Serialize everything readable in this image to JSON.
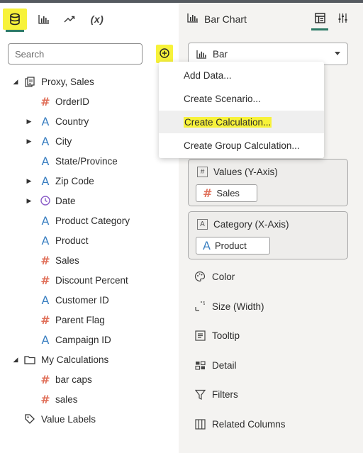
{
  "left_tabs": {
    "data_icon": "database-icon",
    "visualize_icon": "bar-chart-icon",
    "analytics_icon": "trend-line-icon",
    "calc_label": "(x)"
  },
  "search": {
    "placeholder": "Search",
    "value": ""
  },
  "add_button_icon": "plus-circle-icon",
  "tree": {
    "dataset": {
      "label": "Proxy, Sales",
      "icon": "dataset-icon"
    },
    "columns": [
      {
        "label": "OrderID",
        "type": "measure",
        "expandable": false
      },
      {
        "label": "Country",
        "type": "attribute",
        "expandable": true
      },
      {
        "label": "City",
        "type": "attribute",
        "expandable": true
      },
      {
        "label": "State/Province",
        "type": "attribute",
        "expandable": false
      },
      {
        "label": "Zip Code",
        "type": "attribute",
        "expandable": true
      },
      {
        "label": "Date",
        "type": "time",
        "expandable": true
      },
      {
        "label": "Product Category",
        "type": "attribute",
        "expandable": false
      },
      {
        "label": "Product",
        "type": "attribute",
        "expandable": false
      },
      {
        "label": "Sales",
        "type": "measure",
        "expandable": false
      },
      {
        "label": "Discount Percent",
        "type": "measure",
        "expandable": false
      },
      {
        "label": "Customer ID",
        "type": "attribute",
        "expandable": false
      },
      {
        "label": "Parent Flag",
        "type": "measure",
        "expandable": false
      },
      {
        "label": "Campaign ID",
        "type": "attribute",
        "expandable": false
      }
    ],
    "calculations": {
      "label": "My Calculations",
      "items": [
        {
          "label": "bar caps",
          "type": "measure"
        },
        {
          "label": "sales",
          "type": "measure"
        }
      ]
    },
    "value_labels": {
      "label": "Value Labels",
      "icon": "tag-icon"
    }
  },
  "right_panel": {
    "title": "Bar Chart",
    "chart_type": "Bar",
    "header_icons": [
      "layout-panel-icon",
      "settings-sliders-icon"
    ]
  },
  "menu": {
    "items": [
      {
        "label": "Add Data..."
      },
      {
        "label": "Create Scenario..."
      },
      {
        "label": "Create Calculation..."
      },
      {
        "label": "Create Group Calculation..."
      }
    ]
  },
  "dropzones": {
    "values": {
      "title": "Values (Y-Axis)",
      "chip": "Sales"
    },
    "category": {
      "title": "Category (X-Axis)",
      "chip": "Product"
    }
  },
  "properties": [
    {
      "label": "Color",
      "icon": "palette-icon"
    },
    {
      "label": "Size (Width)",
      "icon": "resize-icon"
    },
    {
      "label": "Tooltip",
      "icon": "tooltip-icon"
    },
    {
      "label": "Detail",
      "icon": "detail-icon"
    },
    {
      "label": "Filters",
      "icon": "filter-icon"
    },
    {
      "label": "Related Columns",
      "icon": "columns-icon"
    }
  ],
  "colors": {
    "highlight": "#f7f23a",
    "accent": "#2d7a66",
    "attribute_icon": "#3a7fc1",
    "measure_icon": "#e0705a",
    "time_icon": "#8a5cc7"
  }
}
